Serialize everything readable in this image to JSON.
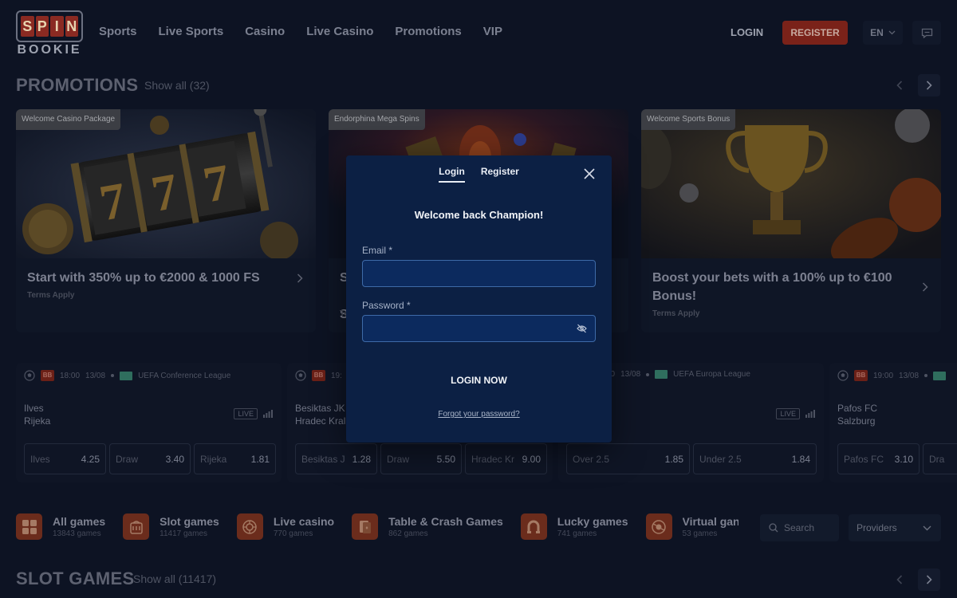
{
  "header": {
    "logo_top": "SPIN",
    "logo_bottom": "BOOKIE",
    "nav": [
      "Sports",
      "Live Sports",
      "Casino",
      "Live Casino",
      "Promotions",
      "VIP"
    ],
    "login": "LOGIN",
    "register": "REGISTER",
    "language": "EN"
  },
  "promotions": {
    "title": "PROMOTIONS",
    "show_all": "Show all (32)",
    "cards": [
      {
        "tag": "Welcome Casino Package",
        "text": "Start with 350% up to €2000 & 1000 FS",
        "terms": "Terms Apply"
      },
      {
        "tag": "Endorphina Mega Spins",
        "text": "S  S",
        "terms": "Te"
      },
      {
        "tag": "Welcome Sports Bonus",
        "text": "Boost your bets with a 100% up to €100 Bonus!",
        "terms": "Terms Apply"
      }
    ]
  },
  "matches": [
    {
      "time": "18:00",
      "date": "13/08",
      "league": "UEFA Conference League",
      "home": "Ilves",
      "away": "Rijeka",
      "live": "LIVE",
      "odds": [
        {
          "label": "Ilves",
          "value": "4.25"
        },
        {
          "label": "Draw",
          "value": "3.40"
        },
        {
          "label": "Rijeka",
          "value": "1.81"
        }
      ]
    },
    {
      "time": "19:",
      "date": "",
      "league": "",
      "home": "Besiktas JK",
      "away": "Hradec Kral",
      "live": "",
      "odds": [
        {
          "label": "Besiktas J",
          "value": "1.28"
        },
        {
          "label": "Draw",
          "value": "5.50"
        },
        {
          "label": "Hradec Kr",
          "value": "9.00"
        }
      ]
    },
    {
      "time": "00",
      "date": "13/08",
      "league": "UEFA Europa League",
      "home": "",
      "away": "",
      "live": "LIVE",
      "odds": [
        {
          "label": "Over 2.5",
          "value": "1.85"
        },
        {
          "label": "Under 2.5",
          "value": "1.84"
        }
      ]
    },
    {
      "time": "19:00",
      "date": "13/08",
      "league": "",
      "home": "Pafos FC",
      "away": "Salzburg",
      "live": "",
      "odds": [
        {
          "label": "Pafos FC",
          "value": "3.10"
        },
        {
          "label": "Dra",
          "value": ""
        }
      ]
    }
  ],
  "categories": [
    {
      "name": "All games",
      "count": "13843 games",
      "icon": "grid-icon"
    },
    {
      "name": "Slot games",
      "count": "11417 games",
      "icon": "slot-machine-icon"
    },
    {
      "name": "Live casino",
      "count": "770 games",
      "icon": "roulette-icon"
    },
    {
      "name": "Table & Crash Games",
      "count": "862 games",
      "icon": "cards-icon"
    },
    {
      "name": "Lucky games",
      "count": "741 games",
      "icon": "horseshoe-icon"
    },
    {
      "name": "Virtual gan",
      "count": "53 games",
      "icon": "virtual-icon"
    }
  ],
  "search": {
    "placeholder": "Search"
  },
  "providers": {
    "label": "Providers"
  },
  "slot_section": {
    "title": "SLOT GAMES",
    "show_all": "Show all (11417)"
  },
  "modal": {
    "tab_login": "Login",
    "tab_register": "Register",
    "welcome": "Welcome back Champion!",
    "email_label": "Email *",
    "password_label": "Password *",
    "submit": "LOGIN NOW",
    "forgot": "Forgot your password?"
  },
  "colors": {
    "accent": "#7a2219",
    "modal_bg": "#0c2044",
    "page_bg": "#0d1323"
  }
}
